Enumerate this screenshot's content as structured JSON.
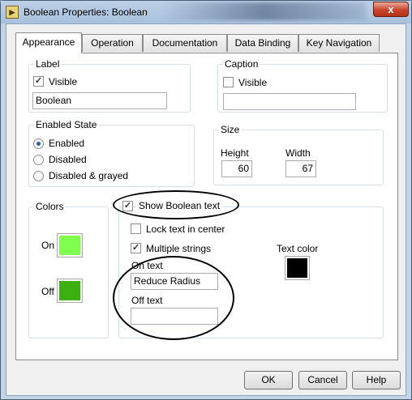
{
  "window": {
    "title": "Boolean Properties: Boolean",
    "icon": "labview-vi-icon",
    "close_glyph": "x"
  },
  "tabs": [
    {
      "label": "Appearance",
      "active": true
    },
    {
      "label": "Operation",
      "active": false
    },
    {
      "label": "Documentation",
      "active": false
    },
    {
      "label": "Data Binding",
      "active": false
    },
    {
      "label": "Key Navigation",
      "active": false
    }
  ],
  "label_group": {
    "title": "Label",
    "visible_label": "Visible",
    "visible_checked": true,
    "value": "Boolean"
  },
  "caption_group": {
    "title": "Caption",
    "visible_label": "Visible",
    "visible_checked": false,
    "value": ""
  },
  "enabled_state": {
    "title": "Enabled State",
    "options": [
      "Enabled",
      "Disabled",
      "Disabled & grayed"
    ],
    "selected": "Enabled"
  },
  "size": {
    "title": "Size",
    "height_label": "Height",
    "height_value": "60",
    "width_label": "Width",
    "width_value": "67"
  },
  "colors": {
    "title": "Colors",
    "on_label": "On",
    "on_color": "#80ff50",
    "off_label": "Off",
    "off_color": "#3cb010"
  },
  "boolean_text": {
    "show_label": "Show Boolean text",
    "show_checked": true,
    "lock_label": "Lock text in center",
    "lock_checked": false,
    "multiple_label": "Multiple strings",
    "multiple_checked": true,
    "on_text_label": "On text",
    "on_text_value": "Reduce Radius",
    "off_text_label": "Off text",
    "off_text_value": "",
    "text_color_label": "Text color",
    "text_color": "#000000"
  },
  "buttons": {
    "ok": "OK",
    "cancel": "Cancel",
    "help": "Help"
  }
}
